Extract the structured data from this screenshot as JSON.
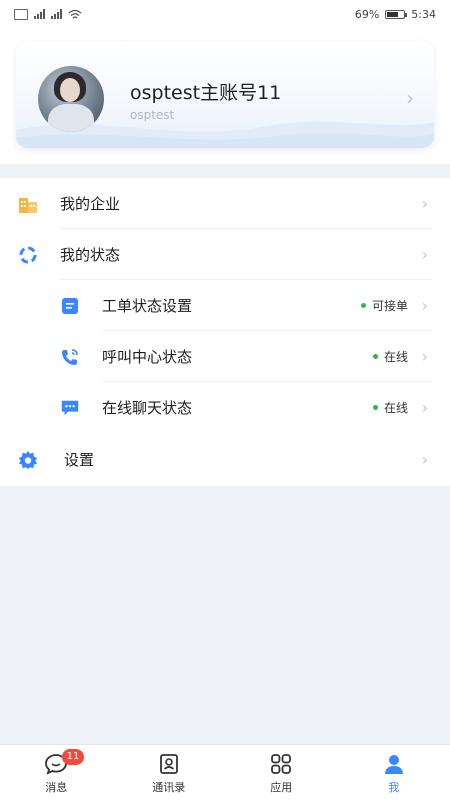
{
  "status_bar": {
    "battery": "69%",
    "time": "5:34",
    "battery_level": 0.69
  },
  "profile": {
    "name": "osptest主账号11",
    "username": "osptest"
  },
  "menu": {
    "items": [
      {
        "label": "我的企业"
      },
      {
        "label": "我的状态"
      },
      {
        "label": "工单状态设置",
        "status": "可接单"
      },
      {
        "label": "呼叫中心状态",
        "status": "在线"
      },
      {
        "label": "在线聊天状态",
        "status": "在线"
      },
      {
        "label": "设置"
      }
    ]
  },
  "tabbar": {
    "tabs": [
      {
        "label": "消息",
        "icon": "chat-bubble-icon",
        "badge": "11"
      },
      {
        "label": "通讯录",
        "icon": "contacts-icon"
      },
      {
        "label": "应用",
        "icon": "apps-grid-icon"
      },
      {
        "label": "我",
        "icon": "person-icon",
        "active": true
      }
    ]
  },
  "colors": {
    "accent": "#3a86ff",
    "online": "#35b24a",
    "badge": "#f24a3d",
    "enterprise": "#f5b53d"
  }
}
